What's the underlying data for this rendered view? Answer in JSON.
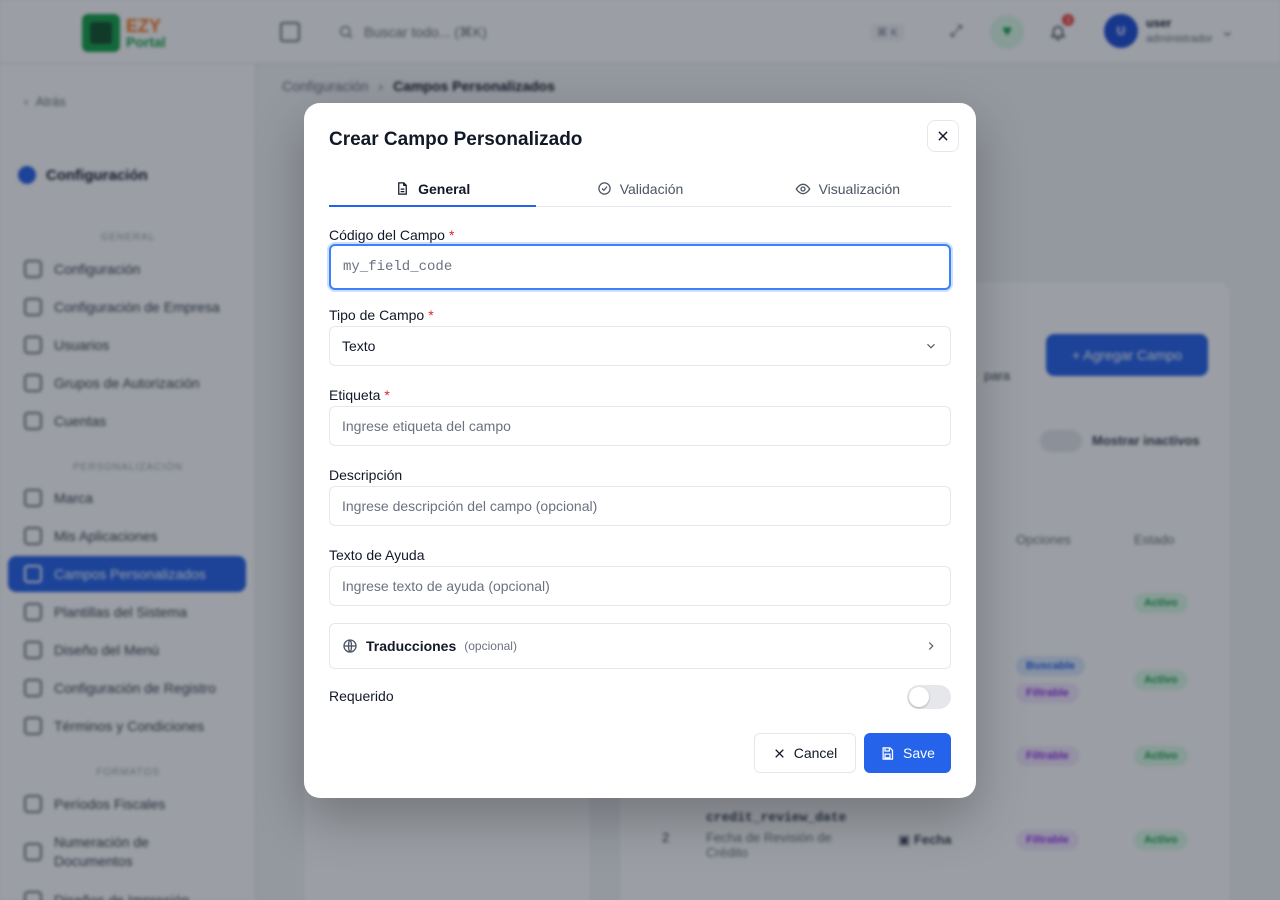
{
  "topbar": {
    "logo_line1": "EZY",
    "logo_line2": "Portal",
    "search_placeholder": "Buscar todo... (⌘K)",
    "search_shortcut": "⌘ K",
    "notification_count": "3",
    "user_initial": "U",
    "user_name": "user",
    "user_role": "administrador"
  },
  "sidebar": {
    "back_label": "Atrás",
    "section_title": "Configuración",
    "groups": [
      {
        "label": "GENERAL",
        "items": [
          "Configuración",
          "Configuración de Empresa",
          "Usuarios",
          "Grupos de Autorización",
          "Cuentas"
        ]
      },
      {
        "label": "PERSONALIZACIÓN",
        "items": [
          "Marca",
          "Mis Aplicaciones",
          "Campos Personalizados",
          "Plantillas del Sistema",
          "Diseño del Menú",
          "Configuración de Registro",
          "Términos y Condiciones"
        ]
      },
      {
        "label": "FORMATOS",
        "items": [
          "Períodos Fiscales",
          "Numeración de Documentos",
          "Diseños de Impresión"
        ]
      }
    ],
    "active_item": "Campos Personalizados"
  },
  "breadcrumb": {
    "parent": "Configuración",
    "current": "Campos Personalizados"
  },
  "background": {
    "add_button": "+ Agregar Campo",
    "desc_fragment": "para",
    "show_inactive": "Mostrar inactivos",
    "col_options": "Opciones",
    "col_status": "Estado",
    "row_code": "credit_review_date",
    "row_label": "Fecha de Revisión de Crédito",
    "row_type": "Fecha",
    "row_index": "2",
    "badge_searchable": "Buscable",
    "badge_filterable": "Filtrable",
    "badge_active": "Activo"
  },
  "modal": {
    "title": "Crear Campo Personalizado",
    "tabs": [
      {
        "label": "General",
        "icon": "file-text-icon"
      },
      {
        "label": "Validación",
        "icon": "check-circle-icon"
      },
      {
        "label": "Visualización",
        "icon": "eye-icon"
      }
    ],
    "fields": {
      "code": {
        "label": "Código del Campo",
        "required": "*",
        "placeholder": "my_field_code",
        "value": ""
      },
      "type": {
        "label": "Tipo de Campo",
        "required": "*",
        "value": "Texto"
      },
      "label": {
        "label": "Etiqueta",
        "required": "*",
        "placeholder": "Ingrese etiqueta del campo",
        "value": ""
      },
      "description": {
        "label": "Descripción",
        "placeholder": "Ingrese descripción del campo (opcional)",
        "value": ""
      },
      "help": {
        "label": "Texto de Ayuda",
        "placeholder": "Ingrese texto de ayuda (opcional)",
        "value": ""
      }
    },
    "translations": {
      "label": "Traducciones",
      "optional": "(opcional)"
    },
    "required_toggle": {
      "label": "Requerido",
      "on": false
    },
    "buttons": {
      "cancel": "Cancel",
      "save": "Save"
    },
    "colors": {
      "primary": "#2563eb",
      "required": "#dc2626",
      "focus_ring": "#3b82f6"
    }
  }
}
